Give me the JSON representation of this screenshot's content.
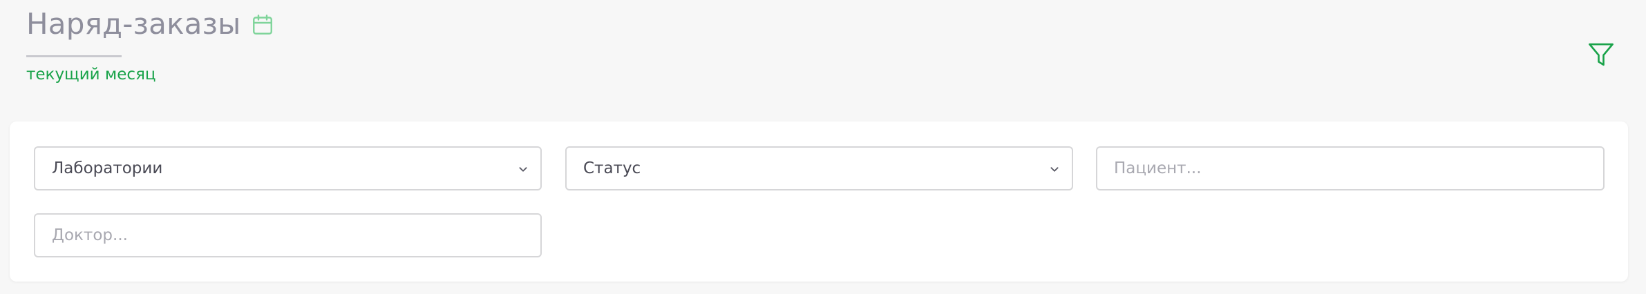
{
  "header": {
    "title": "Наряд-заказы",
    "period_label": "текущий месяц",
    "icons": {
      "calendar": "calendar-icon",
      "filter": "filter-icon"
    },
    "accent_color": "#1aa34a"
  },
  "filters": {
    "laboratory": {
      "value": "Лаборатории",
      "icon": "chevron-down-icon"
    },
    "status": {
      "value": "Статус",
      "icon": "chevron-down-icon"
    },
    "patient": {
      "placeholder": "Пациент...",
      "value": ""
    },
    "doctor": {
      "placeholder": "Доктор...",
      "value": ""
    }
  }
}
